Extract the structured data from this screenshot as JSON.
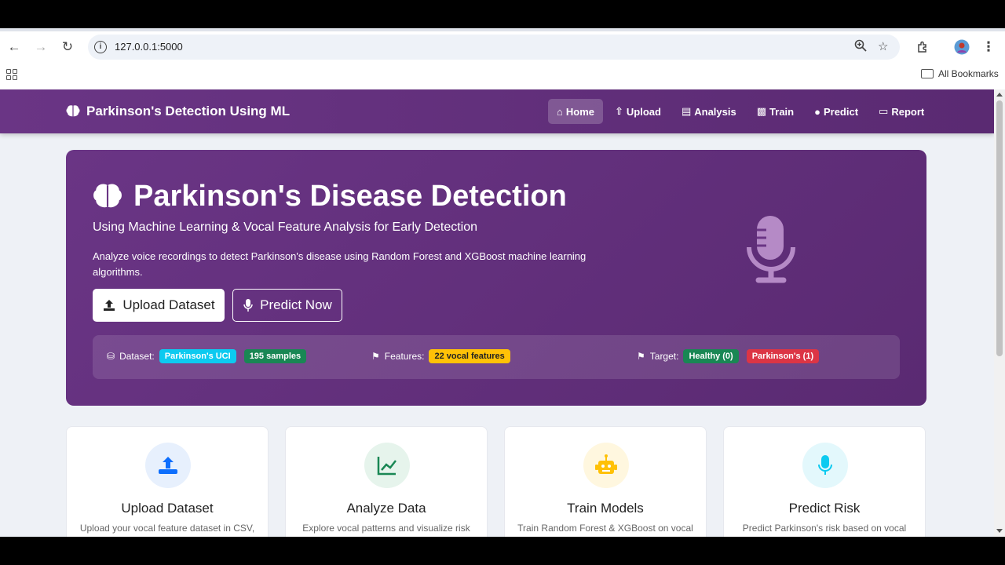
{
  "browser": {
    "url": "127.0.0.1:5000",
    "bookmarks_label": "All Bookmarks"
  },
  "nav": {
    "brand": "Parkinson's Detection Using ML",
    "items": [
      {
        "label": "Home",
        "active": true
      },
      {
        "label": "Upload"
      },
      {
        "label": "Analysis"
      },
      {
        "label": "Train"
      },
      {
        "label": "Predict"
      },
      {
        "label": "Report"
      }
    ]
  },
  "hero": {
    "title": "Parkinson's Disease Detection",
    "subtitle": "Using Machine Learning & Vocal Feature Analysis for Early Detection",
    "description": "Analyze voice recordings to detect Parkinson's disease using Random Forest and XGBoost machine learning algorithms.",
    "upload_label": "Upload Dataset",
    "predict_label": "Predict Now"
  },
  "stats": {
    "dataset_label": "Dataset:",
    "dataset_badge": "Parkinson's UCI",
    "samples_badge": "195 samples",
    "features_label": "Features:",
    "features_badge": "22 vocal features",
    "target_label": "Target:",
    "healthy_badge": "Healthy (0)",
    "parkinsons_badge": "Parkinson's (1)"
  },
  "colors": {
    "primary": "#6a3585",
    "cyan": "#0dcaf0",
    "green": "#198754",
    "yellow": "#ffc107",
    "red": "#dc3545"
  },
  "cards": [
    {
      "title": "Upload Dataset",
      "text": "Upload your vocal feature dataset in CSV,"
    },
    {
      "title": "Analyze Data",
      "text": "Explore vocal patterns and visualize risk"
    },
    {
      "title": "Train Models",
      "text": "Train Random Forest & XGBoost on vocal"
    },
    {
      "title": "Predict Risk",
      "text": "Predict Parkinson's risk based on vocal"
    }
  ]
}
